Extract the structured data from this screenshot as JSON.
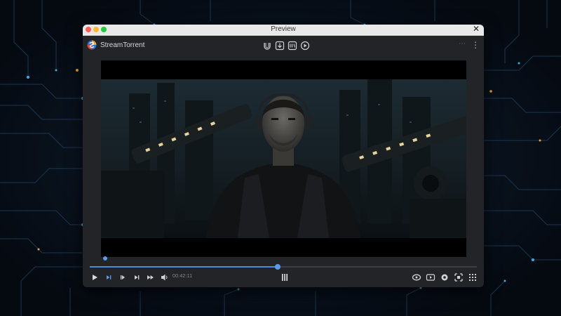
{
  "window": {
    "title": "Preview"
  },
  "app": {
    "name": "StreamTorrent"
  },
  "toolbar_icons": [
    "magnet-link-icon",
    "download-icon",
    "library-icon",
    "play-circle-icon"
  ],
  "player": {
    "progress_fraction": 0.485,
    "time_text": "00:42:11",
    "controls_left": [
      "play-icon",
      "next-chapter-icon",
      "prev-icon",
      "skip-next-icon",
      "fast-forward-icon",
      "volume-icon"
    ],
    "controls_right": [
      "loop-icon",
      "subtitles-icon",
      "settings-icon",
      "picture-in-picture-icon",
      "grid-menu-icon"
    ]
  },
  "colors": {
    "accent": "#4d8dd6",
    "window_bg": "#232427",
    "titlebar": "#e9e9ea"
  }
}
